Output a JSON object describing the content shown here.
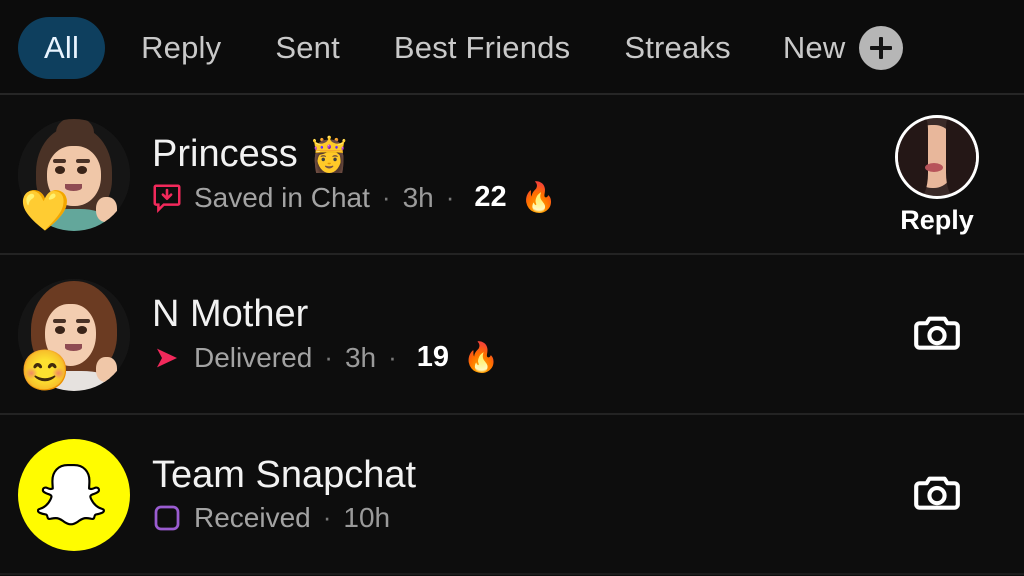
{
  "tabs": [
    {
      "label": "All",
      "active": true
    },
    {
      "label": "Reply",
      "active": false
    },
    {
      "label": "Sent",
      "active": false
    },
    {
      "label": "Best Friends",
      "active": false
    },
    {
      "label": "Streaks",
      "active": false
    }
  ],
  "new_button": {
    "label": "New",
    "icon": "plus-icon"
  },
  "colors": {
    "background": "#0d0d0d",
    "active_tab_bg": "#0e3f5e",
    "divider": "#232323",
    "saved_in_chat": "#f2295b",
    "delivered": "#f2295b",
    "received": "#9a5cd0",
    "snapchat_yellow": "#fffc00",
    "name_text": "#f2f2f2",
    "sub_text": "#9a9a9a"
  },
  "chats": [
    {
      "name": "Princess",
      "name_emoji": "👸",
      "avatar_badge": "💛",
      "avatar_type": "bitmoji-princess",
      "status": "Saved in Chat",
      "status_icon": "saved-in-chat-icon",
      "time": "3h",
      "streak_count": "22",
      "streak_emoji": "🔥",
      "separator": "·",
      "action": {
        "type": "reply-avatar",
        "label": "Reply"
      }
    },
    {
      "name": "N Mother",
      "name_emoji": "",
      "avatar_badge": "😊",
      "avatar_type": "bitmoji-mother",
      "status": "Delivered",
      "status_icon": "delivered-arrow-icon",
      "time": "3h",
      "streak_count": "19",
      "streak_emoji": "🔥",
      "separator": "·",
      "action": {
        "type": "camera",
        "label": ""
      }
    },
    {
      "name": "Team Snapchat",
      "name_emoji": "",
      "avatar_badge": "",
      "avatar_type": "snapchat-logo",
      "status": "Received",
      "status_icon": "received-square-icon",
      "time": "10h",
      "streak_count": "",
      "streak_emoji": "",
      "separator": "·",
      "action": {
        "type": "camera",
        "label": ""
      }
    }
  ]
}
